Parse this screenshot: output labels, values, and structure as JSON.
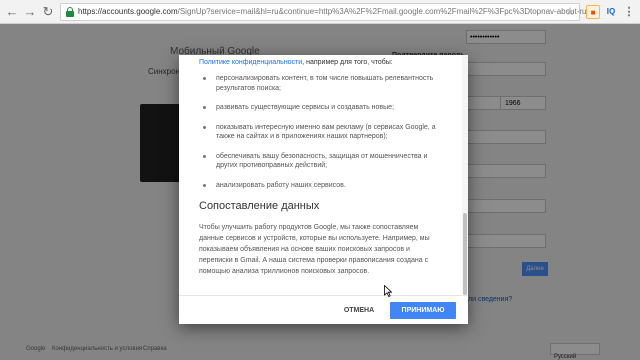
{
  "browser": {
    "url_main": "https://accounts.google.com",
    "url_rest": "/SignUp?service=mail&hl=ru&continue=http%3A%2F%2Fmail.google.com%2Fmail%2F%3Fpc%3Dtopnav-about-ru",
    "back_icon": "arrow-left-icon",
    "forward_icon": "arrow-right-icon",
    "reload_icon": "reload-icon",
    "ext_iq_label": "IQ"
  },
  "background_page": {
    "title": "Мобильный Google",
    "subtitle": "Синхронизируйте файлы.",
    "birth_year": "1966",
    "password_mask": "••••••••••••",
    "next_button": "Далее",
    "help_link": "ли сведения?",
    "footer": {
      "google": "Google",
      "terms": "Конфиденциальность и условия",
      "help": "Справка",
      "language": "Русский"
    }
  },
  "dialog": {
    "privacy_link": "Политике конфиденциальности",
    "intro_suffix": ", например для того, чтобы:",
    "bullets": [
      "персонализировать контент, в том числе повышать релевантность результатов поиска;",
      "развивать существующие сервисы и создавать новые;",
      "показывать интересную именно вам рекламу (в сервисах Google, а также на сайтах и в приложениях наших партнеров);",
      "обеспечивать вашу безопасность, защищая от мошенничества и других противоправных действий;",
      "анализировать работу наших сервисов."
    ],
    "section_heading": "Сопоставление данных",
    "section_paragraph": "Чтобы улучшить работу продуктов Google, мы также сопоставляем данные сервисов и устройств, которые вы используете. Например, мы показываем объявления на основе ваших поисковых запросов и переписки в Gmail. А наша система проверки правописания создана с помощью анализа триллионов поисковых запросов.",
    "cancel_label": "ОТМЕНА",
    "accept_label": "ПРИНИМАЮ"
  },
  "colors": {
    "accent": "#4285f4",
    "link": "#1a73e8",
    "secure": "#1e8e3e"
  }
}
